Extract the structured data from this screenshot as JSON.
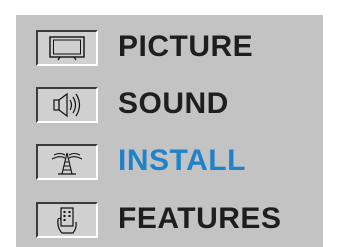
{
  "menu": {
    "items": [
      {
        "label": "PICTURE",
        "icon": "tv-screen-icon",
        "selected": false
      },
      {
        "label": "SOUND",
        "icon": "speaker-icon",
        "selected": false
      },
      {
        "label": "INSTALL",
        "icon": "antenna-icon",
        "selected": true
      },
      {
        "label": "FEATURES",
        "icon": "remote-hand-icon",
        "selected": false
      }
    ]
  },
  "colors": {
    "panel_background": "#c3c3c3",
    "label_text": "#1e1e1e",
    "selected_label_text": "#1e83c8"
  }
}
